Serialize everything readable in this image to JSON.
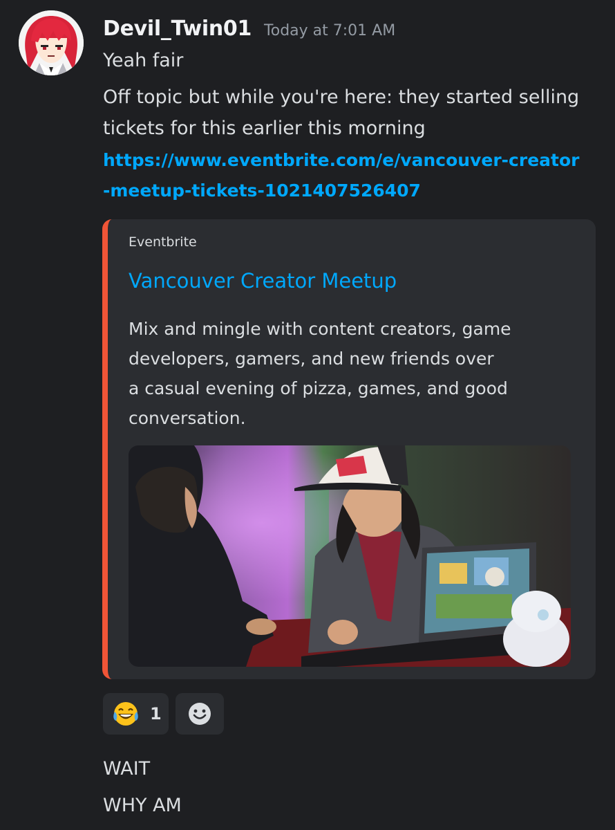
{
  "message": {
    "username": "Devil_Twin01",
    "timestamp": "Today at 7:01 AM",
    "lines": [
      "Yeah fair",
      "Off topic but while you're here: they started selling",
      "tickets for this earlier this morning"
    ],
    "link_lines": [
      "https://www.eventbrite.com/e/vancouver-creator",
      "-meetup-tickets-1021407526407"
    ]
  },
  "embed": {
    "provider": "Eventbrite",
    "title": "Vancouver Creator Meetup",
    "description_lines": [
      "Mix and mingle with content creators, game",
      "developers, gamers, and new friends over",
      "a casual evening of pizza, games, and good",
      "conversation."
    ],
    "accent_color": "#f05537"
  },
  "reactions": [
    {
      "emoji": "joy-emoji",
      "count": "1"
    }
  ],
  "add_reaction_icon": "smile-add-reaction-icon",
  "followups": [
    "WAIT",
    "WHY AM"
  ]
}
